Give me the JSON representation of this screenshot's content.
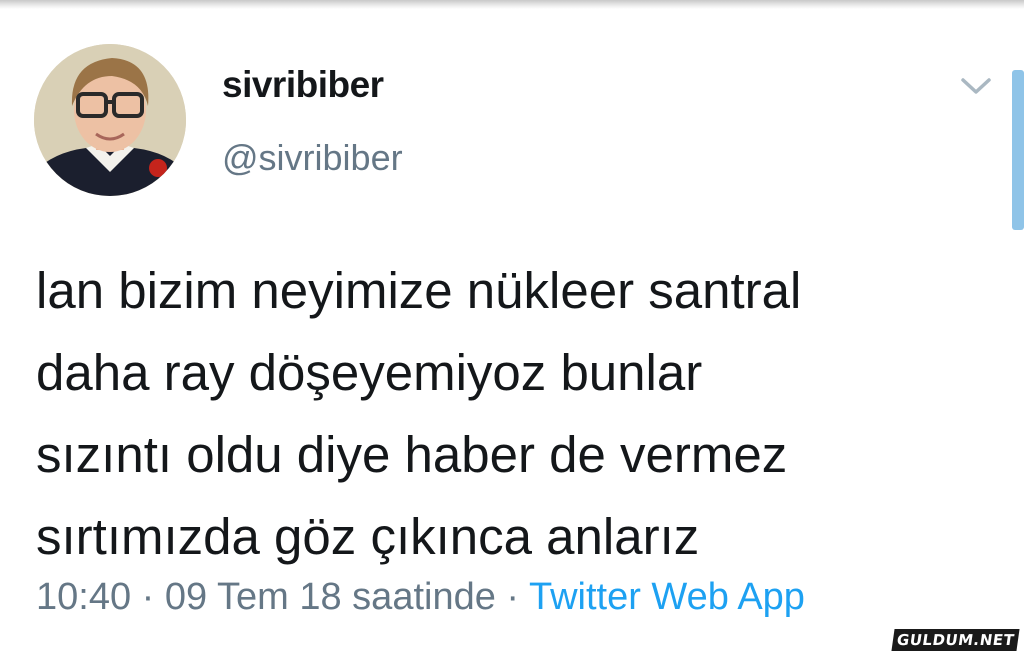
{
  "tweet": {
    "author": {
      "display_name": "sivribiber",
      "handle": "@sivribiber",
      "avatar_icon": "user-avatar"
    },
    "menu_icon": "chevron-down-icon",
    "text_lines": [
      "lan bizim neyimize nükleer santral",
      "daha ray döşeyemiyoz bunlar",
      "sızıntı oldu diye haber de vermez",
      "sırtımızda göz çıkınca anlarız"
    ],
    "time": "10:40",
    "date": "09 Tem 18 saatinde",
    "separator": "·",
    "source": "Twitter Web App"
  },
  "watermark": "GULDUM.NET",
  "colors": {
    "text": "#14171a",
    "muted": "#657786",
    "link": "#1da1f2",
    "scrollbar": "#8fc4e8"
  }
}
